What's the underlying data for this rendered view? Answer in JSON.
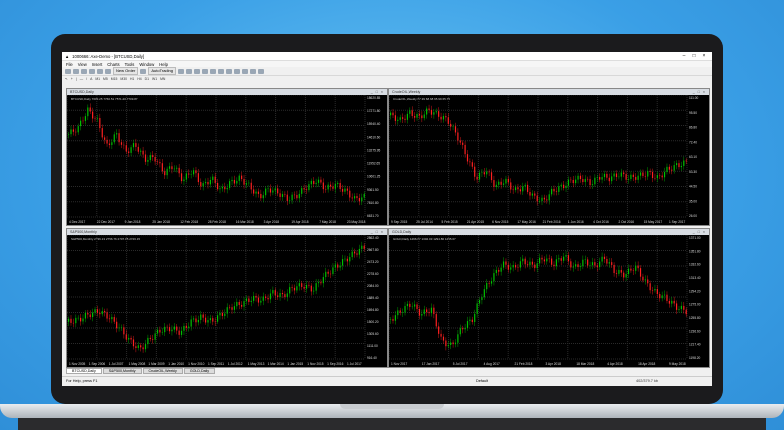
{
  "window": {
    "title": "1000666: Axe-Demo - [BTCUSD,Daily]"
  },
  "menu": [
    "File",
    "View",
    "Insert",
    "Charts",
    "Tools",
    "Window",
    "Help"
  ],
  "toolbar": {
    "new_order": "New Order",
    "autotrading": "AutoTrading"
  },
  "timeframes": [
    "M1",
    "M5",
    "M15",
    "M30",
    "H1",
    "H4",
    "D1",
    "W1",
    "MN"
  ],
  "charts": [
    {
      "title": "BTCUSD,Daily",
      "info": "BTCUSD,Daily  7609.25 7760.51 7571.20 7709.87",
      "x_labels": [
        "4 Dec 2017",
        "22 Dec 2017",
        "9 Jan 2018",
        "25 Jan 2018",
        "12 Feb 2018",
        "28 Feb 2018",
        "16 Mar 2018",
        "3 Apr 2018",
        "19 Apr 2018",
        "7 May 2018",
        "23 May 2018"
      ],
      "y_labels": [
        "18620.85",
        "17271.80",
        "15940.40",
        "14610.60",
        "13275.95",
        "11952.65",
        "10601.25",
        "9361.50",
        "7810.80",
        "6631.70"
      ],
      "price": [
        0.72,
        0.78,
        0.95,
        0.85,
        0.6,
        0.72,
        0.55,
        0.62,
        0.48,
        0.5,
        0.35,
        0.42,
        0.28,
        0.38,
        0.22,
        0.3,
        0.18,
        0.26,
        0.3,
        0.22,
        0.12,
        0.2,
        0.16,
        0.1,
        0.14,
        0.22,
        0.28,
        0.2,
        0.24,
        0.18,
        0.1,
        0.12
      ]
    },
    {
      "title": "CrudeOIL,Weekly",
      "info": "CrudeOIL,Weekly  67.39 68.68 65.99 65.75",
      "x_labels": [
        "9 Sep 2015",
        "25 Jul 2014",
        "5 Feb 2015",
        "21 Apr 2015",
        "6 Nov 2015",
        "17 May 2016",
        "21 Feb 2016",
        "1 Jun 2016",
        "4 Oct 2016",
        "2 Oct 2016",
        "15 May 2017",
        "1 Sep 2017"
      ],
      "y_labels": [
        "111.00",
        "95.50",
        "86.80",
        "72.40",
        "63.10",
        "53.30",
        "44.50",
        "35.00",
        "26.00"
      ],
      "price": [
        0.9,
        0.85,
        0.92,
        0.88,
        0.95,
        0.9,
        0.85,
        0.7,
        0.5,
        0.3,
        0.38,
        0.22,
        0.28,
        0.18,
        0.22,
        0.12,
        0.08,
        0.18,
        0.22,
        0.28,
        0.3,
        0.25,
        0.32,
        0.3,
        0.34,
        0.3,
        0.32,
        0.35,
        0.3,
        0.38,
        0.42,
        0.45
      ]
    },
    {
      "title": "S&P500,Monthly",
      "info": "S&P500,Monthly  2736.13 2756.76 2707.05 2726.15",
      "x_labels": [
        "1 Nov 2005",
        "1 Sep 2006",
        "1 Jul 2007",
        "1 May 2008",
        "1 Mar 2009",
        "1 Jan 2010",
        "1 Nov 2010",
        "1 Sep 2011",
        "1 Jul 2012",
        "1 May 2013",
        "1 Mar 2014",
        "1 Jan 2015",
        "1 Nov 2015",
        "1 Sep 2016",
        "1 Jul 2017"
      ],
      "y_labels": [
        "2862.40",
        "2667.80",
        "2473.20",
        "2278.60",
        "2084.00",
        "1889.40",
        "1694.80",
        "1500.20",
        "1305.60",
        "1111.00",
        "916.40"
      ],
      "price": [
        0.28,
        0.3,
        0.35,
        0.38,
        0.32,
        0.22,
        0.1,
        0.02,
        0.12,
        0.2,
        0.22,
        0.18,
        0.28,
        0.32,
        0.28,
        0.35,
        0.42,
        0.45,
        0.5,
        0.48,
        0.55,
        0.52,
        0.6,
        0.62,
        0.58,
        0.7,
        0.78,
        0.85,
        0.92,
        0.98
      ]
    },
    {
      "title": "GOLD,Daily",
      "info": "GOLD,Daily  1296.07 1302.03 1294.86 1295.67",
      "x_labels": [
        "1 Nov 2017",
        "17 Jan 2017",
        "5 Jul 2017",
        "4 Aug 2017",
        "21 Feb 2018",
        "3 Apr 2018",
        "18 Mar 2018",
        "4 Apr 2018",
        "18 Apr 2018",
        "9 May 2018"
      ],
      "y_labels": [
        "1371.00",
        "1351.80",
        "1332.60",
        "1313.40",
        "1294.20",
        "1275.00",
        "1255.80",
        "1236.60",
        "1217.40",
        "1198.20"
      ],
      "price": [
        0.3,
        0.38,
        0.45,
        0.35,
        0.4,
        0.1,
        0.05,
        0.22,
        0.3,
        0.55,
        0.7,
        0.82,
        0.78,
        0.85,
        0.8,
        0.88,
        0.82,
        0.9,
        0.78,
        0.85,
        0.8,
        0.88,
        0.75,
        0.72,
        0.8,
        0.65,
        0.55,
        0.5,
        0.42,
        0.38
      ]
    }
  ],
  "tabs": [
    "BTCUSD,Daily",
    "S&P500,Monthly",
    "CrudeOIL,Weekly",
    "GOLD,Daily"
  ],
  "status": {
    "help": "For Help, press F1",
    "profile": "Default",
    "connection": "402/379.7 kb"
  },
  "colors": {
    "bull": "#00c000",
    "bear": "#ff2020",
    "grid": "#2a2a2a"
  }
}
